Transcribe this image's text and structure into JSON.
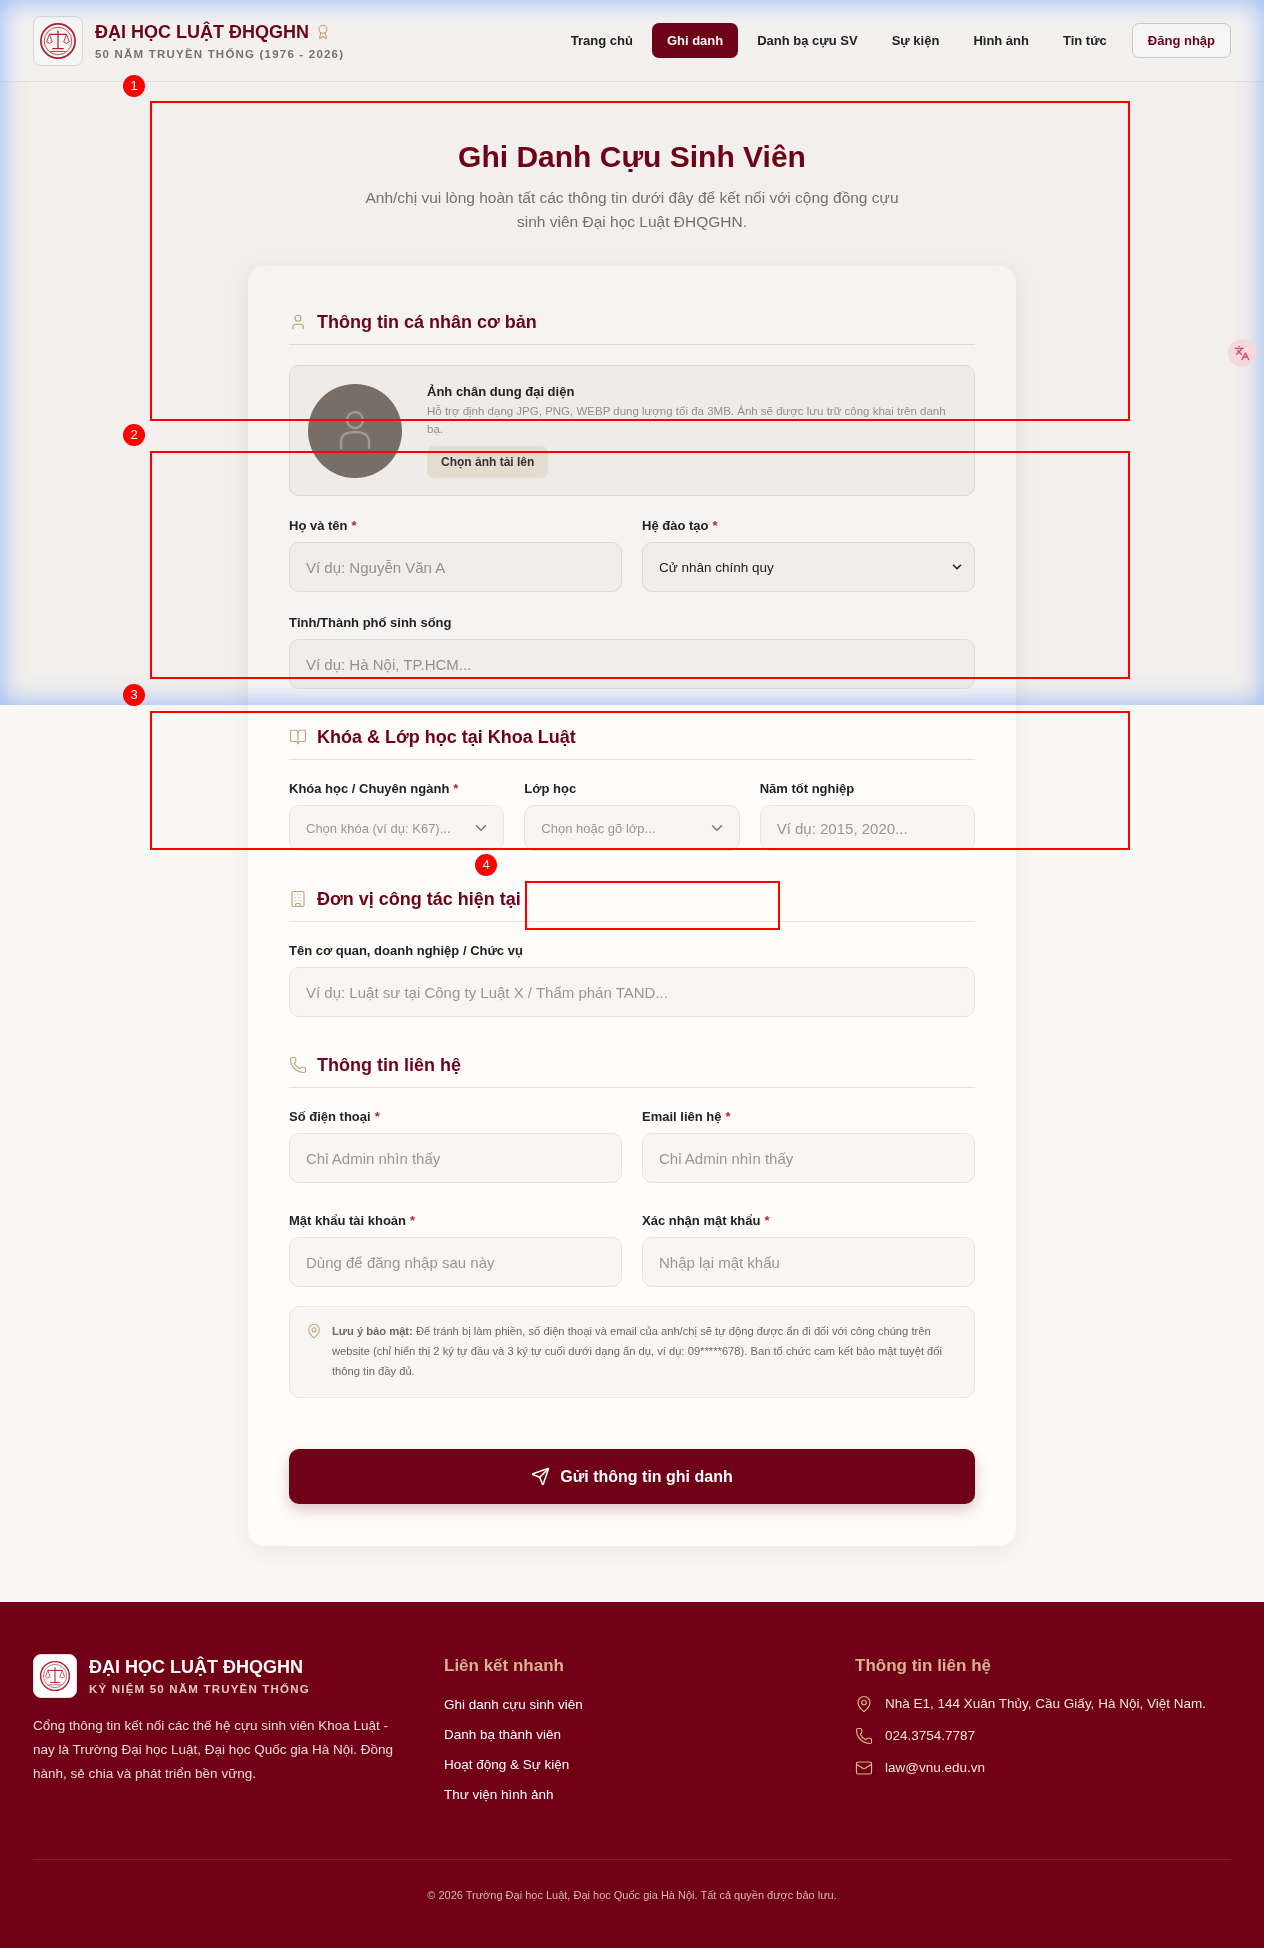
{
  "header": {
    "brand_title": "ĐẠI HỌC LUẬT ĐHQGHN",
    "brand_subtitle": "50 NĂM TRUYỀN THỐNG (1976 - 2026)",
    "nav": [
      {
        "label": "Trang chủ",
        "selected": false
      },
      {
        "label": "Ghi danh",
        "selected": true
      },
      {
        "label": "Danh bạ cựu SV",
        "selected": false
      },
      {
        "label": "Sự kiện",
        "selected": false
      },
      {
        "label": "Hình ảnh",
        "selected": false
      },
      {
        "label": "Tin tức",
        "selected": false
      }
    ],
    "login_button": "Đăng nhập"
  },
  "hero": {
    "title": "Ghi Danh Cựu Sinh Viên",
    "subtitle": "Anh/chị vui lòng hoàn tất các thông tin dưới đây để kết nối với cộng đồng cựu sinh viên Đại học Luật ĐHQGHN."
  },
  "form": {
    "sections": [
      {
        "title": "Thông tin cá nhân cơ bản",
        "photo_upload": {
          "title": "Ảnh chân dung đại diện",
          "hint": "Hỗ trợ định dạng JPG, PNG, WEBP dung lượng tối đa 3MB. Ảnh sẽ được lưu trữ công khai trên danh bạ.",
          "button": "Chọn ảnh tải lên"
        },
        "rows": [
          [
            {
              "kind": "text",
              "label": "Họ và tên",
              "required_mark": "*",
              "placeholder": "Ví dụ: Nguyễn Văn A"
            },
            {
              "kind": "select",
              "label": "Hệ đào tạo",
              "required_mark": "*",
              "value": "Cử nhân chính quy"
            }
          ],
          [
            {
              "kind": "text",
              "label": "Tỉnh/Thành phố sinh sống",
              "placeholder": "Ví dụ: Hà Nội, TP.HCM..."
            }
          ]
        ]
      },
      {
        "title": "Khóa & Lớp học tại Khoa Luật",
        "rows": [
          [
            {
              "kind": "combobox",
              "label": "Khóa học / Chuyên ngành",
              "required_mark": "*",
              "placeholder": "Chọn khóa (ví dụ: K67)..."
            },
            {
              "kind": "combobox",
              "label": "Lớp học",
              "placeholder": "Chọn hoặc gõ lớp..."
            },
            {
              "kind": "text",
              "label": "Năm tốt nghiệp",
              "placeholder": "Ví dụ: 2015, 2020..."
            }
          ]
        ]
      },
      {
        "title": "Đơn vị công tác hiện tại",
        "rows": [
          [
            {
              "kind": "text",
              "label": "Tên cơ quan, doanh nghiệp / Chức vụ",
              "placeholder": "Ví dụ: Luật sư tại Công ty Luật X / Thẩm phán TAND..."
            }
          ]
        ]
      },
      {
        "title": "Thông tin liên hệ",
        "rows": [
          [
            {
              "kind": "text",
              "label": "Số điện thoại",
              "required_mark": "*",
              "placeholder": "Chỉ Admin nhìn thấy"
            },
            {
              "kind": "text",
              "label": "Email liên hệ",
              "required_mark": "*",
              "placeholder": "Chỉ Admin nhìn thấy"
            }
          ],
          [
            {
              "kind": "text",
              "label": "Mật khẩu tài khoản",
              "required_mark": "*",
              "placeholder": "Dùng để đăng nhập sau này"
            },
            {
              "kind": "text",
              "label": "Xác nhận mật khẩu",
              "required_mark": "*",
              "placeholder": "Nhập lại mật khẩu"
            }
          ]
        ]
      }
    ],
    "note": {
      "label": "Lưu ý bảo mật:",
      "text": "Để tránh bị làm phiền, số điện thoại và email của anh/chị sẽ tự động được ẩn đi đối với công chúng trên website (chỉ hiển thị 2 ký tự đầu và 3 ký tự cuối dưới dạng ẩn dụ, ví dụ: 09*****678). Ban tổ chức cam kết bảo mật tuyệt đối thông tin đầy đủ."
    },
    "submit_button": "Gửi thông tin ghi danh"
  },
  "footer": {
    "brand_title": "ĐẠI HỌC LUẬT ĐHQGHN",
    "brand_subtitle": "KỶ NIỆM 50 NĂM TRUYỀN THỐNG",
    "description": "Cổng thông tin kết nối các thế hệ cựu sinh viên Khoa Luật - nay là Trường Đại học Luật, Đại học Quốc gia Hà Nội. Đồng hành, sẻ chia và phát triển bền vững.",
    "links_title": "Liên kết nhanh",
    "links": [
      "Ghi danh cựu sinh viên",
      "Danh bạ thành viên",
      "Hoạt động & Sự kiện",
      "Thư viện hình ảnh"
    ],
    "contact_title": "Thông tin liên hệ",
    "contacts": [
      "Nhà E1, 144 Xuân Thủy, Cầu Giấy, Hà Nội, Việt Nam.",
      "024.3754.7787",
      "law@vnu.edu.vn"
    ],
    "copyright": "© 2026 Trường Đại học Luật, Đại học Quốc gia Hà Nội. Tất cả quyền được bảo lưu."
  },
  "annotations": [
    {
      "number": "1"
    },
    {
      "number": "2"
    },
    {
      "number": "3"
    },
    {
      "number": "4"
    }
  ]
}
